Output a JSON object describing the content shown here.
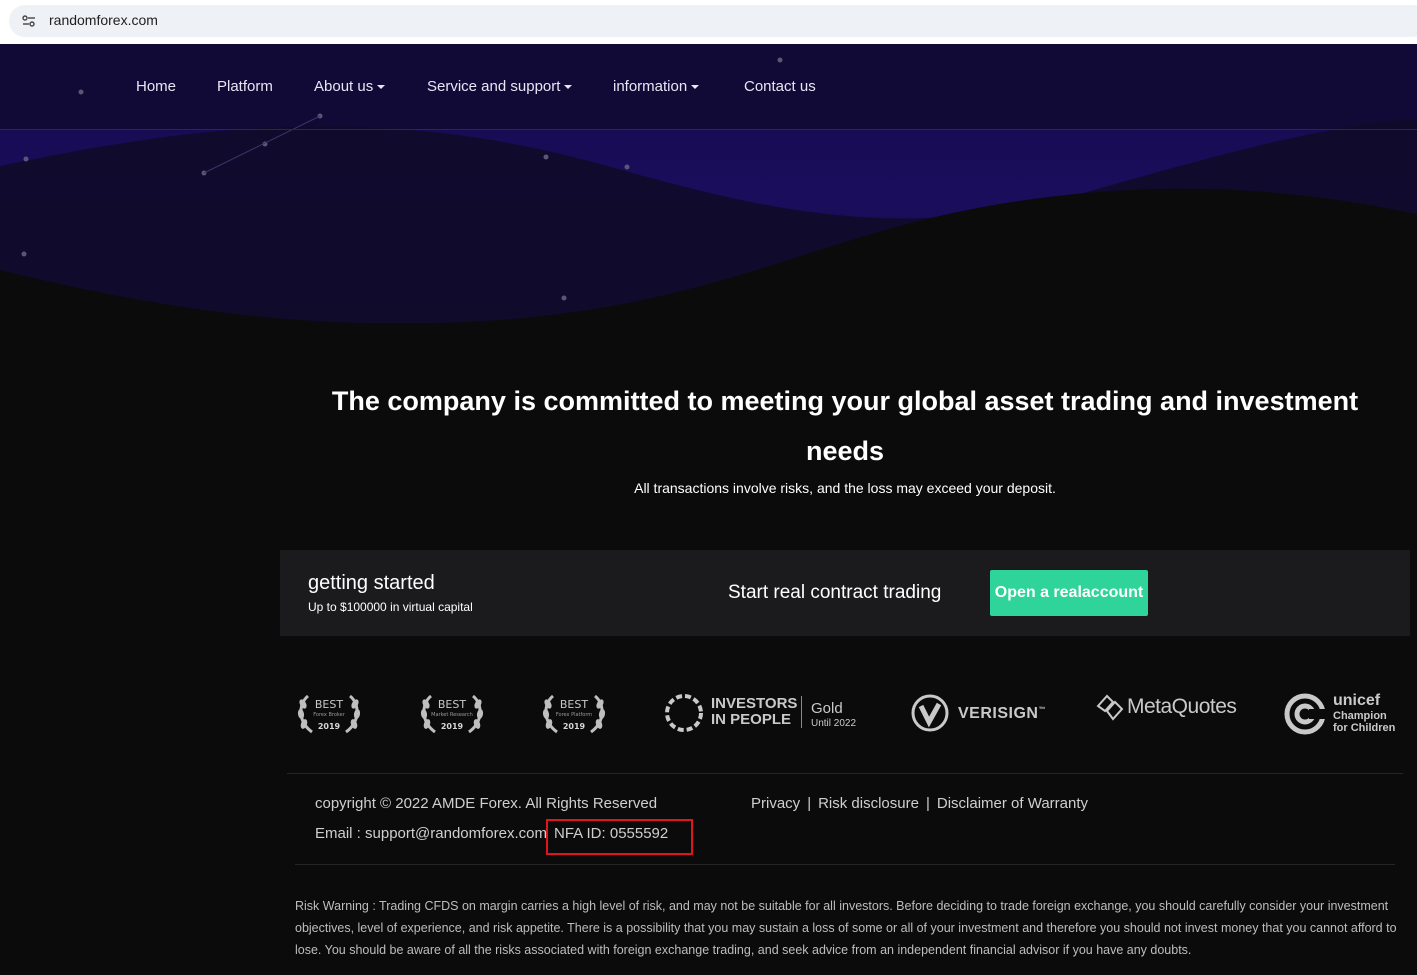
{
  "browser": {
    "url": "randomforex.com",
    "site_info_icon": "tune-icon"
  },
  "nav": {
    "items": [
      {
        "label": "Home",
        "dropdown": false
      },
      {
        "label": "Platform",
        "dropdown": false
      },
      {
        "label": "About us",
        "dropdown": true
      },
      {
        "label": "Service and support",
        "dropdown": true
      },
      {
        "label": "information",
        "dropdown": true
      },
      {
        "label": "Contact us",
        "dropdown": false
      }
    ]
  },
  "hero": {
    "headline": "The company is committed to meeting your global asset trading and investment needs",
    "subline": "All transactions involve risks, and the loss may exceed your deposit."
  },
  "band": {
    "title": "getting started",
    "subtitle": "Up to $100000 in virtual capital",
    "cta_text": "Start real contract trading",
    "button_label": "Open a realaccount",
    "button_color": "#2fd49a"
  },
  "logos": {
    "awards": [
      {
        "best": "BEST",
        "caption": "Forex Broker",
        "year": "2019"
      },
      {
        "best": "BEST",
        "caption": "Market Research",
        "year": "2019"
      },
      {
        "best": "BEST",
        "caption": "Forex Platform",
        "year": "2019"
      }
    ],
    "investors": {
      "line1": "INVESTORS",
      "line2": "IN PEOPLE",
      "gold": "Gold",
      "until": "Until 2022"
    },
    "verisign": "VERISIGN",
    "verisign_tm": "™",
    "metaquotes": "MetaQuotes",
    "unicef": {
      "title": "unicef",
      "line1": "Champion",
      "line2": "for Children"
    }
  },
  "footer": {
    "copyright": "copyright © 2022 AMDE Forex. All Rights Reserved",
    "links": [
      "Privacy",
      "Risk disclosure",
      "Disclaimer of Warranty"
    ],
    "link_separator": "|",
    "email": "Email : support@randomforex.com",
    "nfa": "NFA ID: 0555592",
    "highlight_color": "#e0141b",
    "risk_warning": "Risk Warning : Trading CFDS on margin carries a high level of risk, and may not be suitable for all investors. Before deciding to trade foreign exchange, you should carefully consider your investment objectives, level of experience, and risk appetite. There is a possibility that you may sustain a loss of some or all of your investment and therefore you should not invest money that you cannot afford to lose. You should be aware of all the risks associated with foreign exchange trading, and seek advice from an independent financial advisor if you have any doubts."
  }
}
